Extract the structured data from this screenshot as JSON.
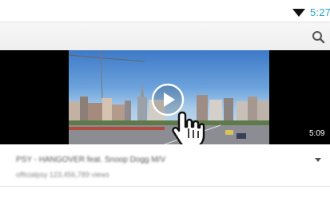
{
  "status_bar": {
    "time": "5:27",
    "wifi_icon": "wifi-icon"
  },
  "action_bar": {
    "search_icon": "search-icon"
  },
  "player": {
    "duration": "5:09",
    "play_icon": "play-icon",
    "cursor_icon": "hand-pointer-icon"
  },
  "video": {
    "title": "PSY - HANGOVER feat. Snoop Dogg M/V",
    "meta": "officialpsy   123,456,789 views",
    "expand_icon": "chevron-down-icon"
  },
  "colors": {
    "time_text": "#27a3c7",
    "action_bar": "#f2f2f2"
  }
}
